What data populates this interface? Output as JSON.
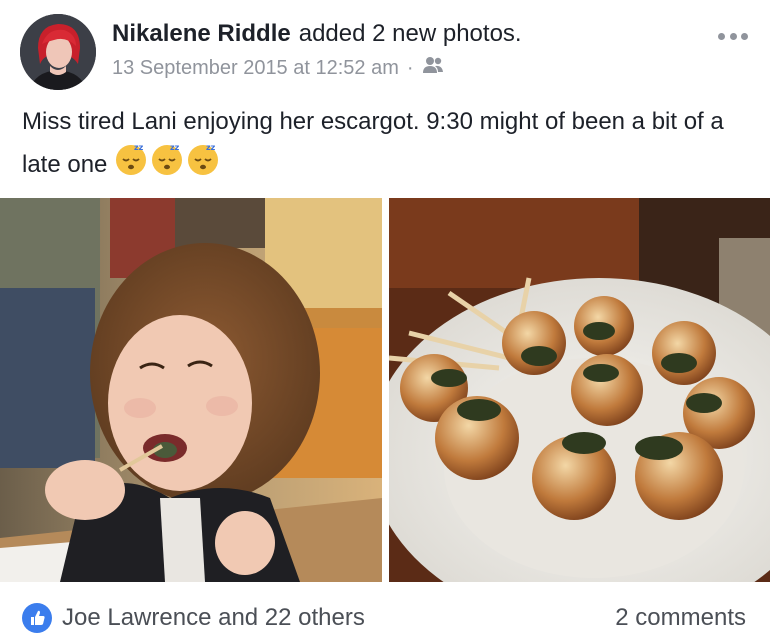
{
  "post": {
    "author": "Nikalene Riddle",
    "action": "added 2 new photos.",
    "timestamp": "13 September 2015 at 12:52 am",
    "separator": "·",
    "audience_icon": "friends-icon",
    "more_icon": "more-options-icon",
    "text": "Miss tired Lani enjoying her escargot. 9:30 might of been a bit of a late one",
    "emojis": [
      "sleeping-face",
      "sleeping-face",
      "sleeping-face"
    ],
    "photos": [
      {
        "icon": "photo-girl-eating-escargot"
      },
      {
        "icon": "photo-escargot-plate"
      }
    ]
  },
  "footer": {
    "like_icon": "thumbs-up-icon",
    "likes": "Joe Lawrence and 22 others",
    "comments": "2 comments"
  },
  "colors": {
    "secondary_text": "#90949c",
    "like_blue": "#3b7ded"
  }
}
